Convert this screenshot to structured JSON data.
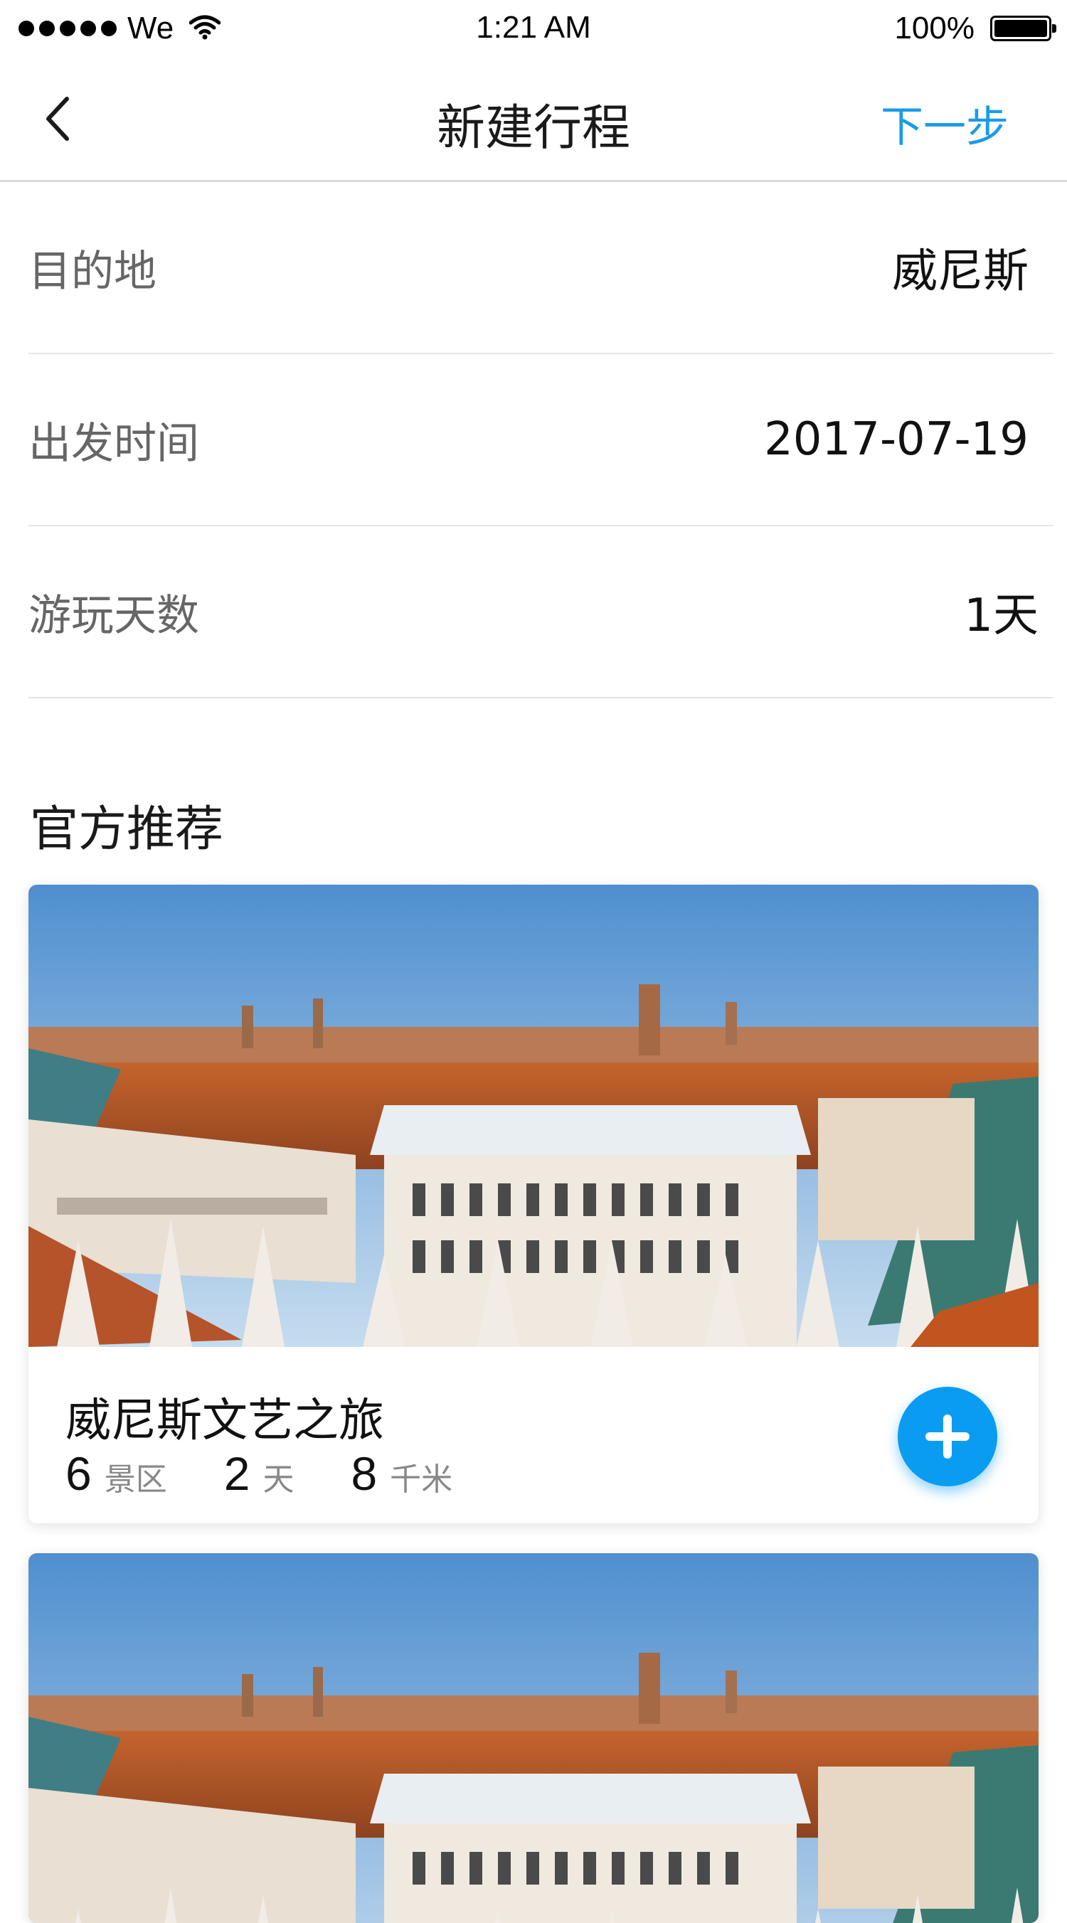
{
  "status_bar": {
    "carrier": "We",
    "time": "1:21 AM",
    "battery": "100%"
  },
  "nav": {
    "title": "新建行程",
    "next_label": "下一步"
  },
  "form": {
    "destination": {
      "label": "目的地",
      "value": "威尼斯"
    },
    "departure": {
      "label": "出发时间",
      "value": "2017-07-19"
    },
    "days": {
      "label": "游玩天数",
      "value": "1天"
    }
  },
  "section": {
    "title": "官方推荐"
  },
  "cards": [
    {
      "title": "威尼斯文艺之旅",
      "stats": [
        {
          "value": "6",
          "unit": "景区"
        },
        {
          "value": "2",
          "unit": "天"
        },
        {
          "value": "8",
          "unit": "千米"
        }
      ]
    }
  ],
  "colors": {
    "accent": "#1a9be8",
    "add_button": "#0a9cf0"
  },
  "icons": {
    "back": "chevron-left-icon",
    "signal": "signal-dots-icon",
    "wifi": "wifi-icon",
    "battery": "battery-icon",
    "add": "plus-icon"
  }
}
